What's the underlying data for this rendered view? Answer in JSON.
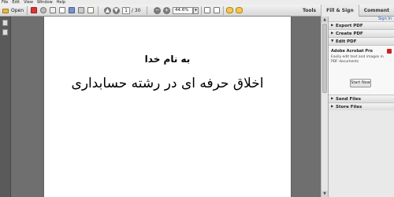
{
  "menu": [
    "File",
    "Edit",
    "View",
    "Window",
    "Help"
  ],
  "toolbar": {
    "open_label": "Open",
    "page_current": "1",
    "page_total": "/ 30",
    "zoom": "44.6%",
    "zoom_out_symbol": "−",
    "zoom_in_symbol": "+",
    "prev_symbol": "▲",
    "next_symbol": "▼",
    "dropdown_symbol": "▾"
  },
  "tabs": [
    "Tools",
    "Fill & Sign",
    "Comment"
  ],
  "document": {
    "heading": "به نام خدا",
    "title": "اخلاق حرفه ای در رشته حسابداری"
  },
  "right_pane": {
    "sign_in": "Sign In",
    "sections": {
      "export": "Export PDF",
      "create": "Create PDF",
      "edit": "Edit PDF",
      "send": "Send Files",
      "store": "Store Files"
    },
    "collapsed_symbol": "▶",
    "expanded_symbol": "▼",
    "edit_product": "Adobe Acrobat Pro",
    "edit_desc": "Easily edit text and images in PDF documents",
    "start_now": "Start Now"
  },
  "scroll": {
    "up": "▲",
    "down": "▼"
  }
}
